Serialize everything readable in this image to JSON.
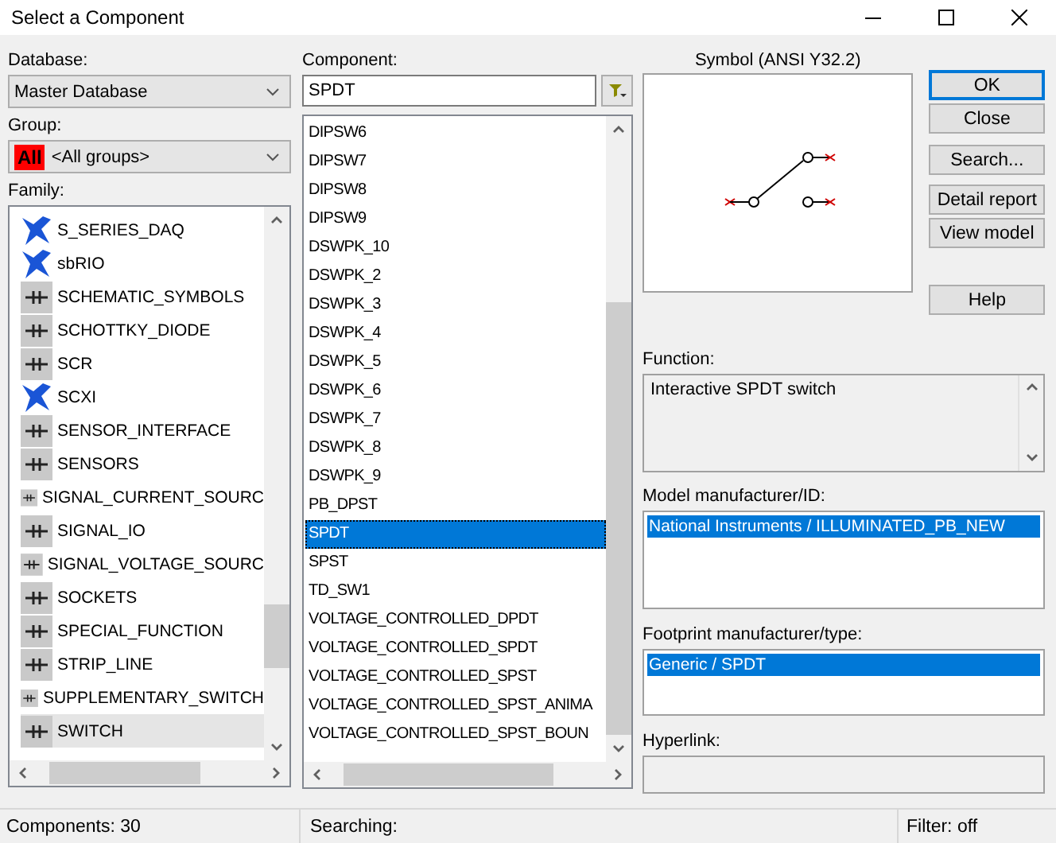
{
  "window": {
    "title": "Select a Component"
  },
  "database": {
    "label": "Database:",
    "value": "Master Database"
  },
  "group": {
    "label": "Group:",
    "badge": "All",
    "value": "<All groups>"
  },
  "family": {
    "label": "Family:",
    "items": [
      {
        "name": "S_SERIES_DAQ",
        "selected": false
      },
      {
        "name": "sbRIO",
        "selected": false
      },
      {
        "name": "SCHEMATIC_SYMBOLS",
        "selected": false
      },
      {
        "name": "SCHOTTKY_DIODE",
        "selected": false
      },
      {
        "name": "SCR",
        "selected": false
      },
      {
        "name": "SCXI",
        "selected": false
      },
      {
        "name": "SENSOR_INTERFACE",
        "selected": false
      },
      {
        "name": "SENSORS",
        "selected": false
      },
      {
        "name": "SIGNAL_CURRENT_SOURC",
        "selected": false
      },
      {
        "name": "SIGNAL_IO",
        "selected": false
      },
      {
        "name": "SIGNAL_VOLTAGE_SOURC",
        "selected": false
      },
      {
        "name": "SOCKETS",
        "selected": false
      },
      {
        "name": "SPECIAL_FUNCTION",
        "selected": false
      },
      {
        "name": "STRIP_LINE",
        "selected": false
      },
      {
        "name": "SUPPLEMENTARY_SWITCH",
        "selected": false
      },
      {
        "name": "SWITCH",
        "selected": true
      }
    ]
  },
  "component": {
    "label": "Component:",
    "value": "SPDT",
    "items": [
      {
        "name": "DIPSW6",
        "selected": false
      },
      {
        "name": "DIPSW7",
        "selected": false
      },
      {
        "name": "DIPSW8",
        "selected": false
      },
      {
        "name": "DIPSW9",
        "selected": false
      },
      {
        "name": "DSWPK_10",
        "selected": false
      },
      {
        "name": "DSWPK_2",
        "selected": false
      },
      {
        "name": "DSWPK_3",
        "selected": false
      },
      {
        "name": "DSWPK_4",
        "selected": false
      },
      {
        "name": "DSWPK_5",
        "selected": false
      },
      {
        "name": "DSWPK_6",
        "selected": false
      },
      {
        "name": "DSWPK_7",
        "selected": false
      },
      {
        "name": "DSWPK_8",
        "selected": false
      },
      {
        "name": "DSWPK_9",
        "selected": false
      },
      {
        "name": "PB_DPST",
        "selected": false
      },
      {
        "name": "SPDT",
        "selected": true
      },
      {
        "name": "SPST",
        "selected": false
      },
      {
        "name": "TD_SW1",
        "selected": false
      },
      {
        "name": "VOLTAGE_CONTROLLED_DPDT",
        "selected": false
      },
      {
        "name": "VOLTAGE_CONTROLLED_SPDT",
        "selected": false
      },
      {
        "name": "VOLTAGE_CONTROLLED_SPST",
        "selected": false
      },
      {
        "name": "VOLTAGE_CONTROLLED_SPST_ANIMA",
        "selected": false
      },
      {
        "name": "VOLTAGE_CONTROLLED_SPST_BOUN",
        "selected": false
      }
    ]
  },
  "symbol": {
    "title": "Symbol (ANSI Y32.2)"
  },
  "buttons": [
    {
      "label": "OK",
      "default": true
    },
    {
      "label": "Close",
      "default": false
    },
    {
      "label": "Search...",
      "default": false
    },
    {
      "label": "Detail report",
      "default": false
    },
    {
      "label": "View model",
      "default": false
    },
    {
      "label": "Help",
      "default": false
    }
  ],
  "function": {
    "label": "Function:",
    "text": "Interactive SPDT switch"
  },
  "model": {
    "label": "Model manufacturer/ID:",
    "items": [
      {
        "text": "National Instruments / ILLUMINATED_PB_NEW",
        "selected": true
      }
    ]
  },
  "footprint": {
    "label": "Footprint manufacturer/type:",
    "items": [
      {
        "text": "Generic / SPDT",
        "selected": true
      }
    ]
  },
  "hyperlink": {
    "label": "Hyperlink:"
  },
  "status_bar": {
    "components": "Components: 30",
    "searching": "Searching:",
    "filter": "Filter: off"
  }
}
